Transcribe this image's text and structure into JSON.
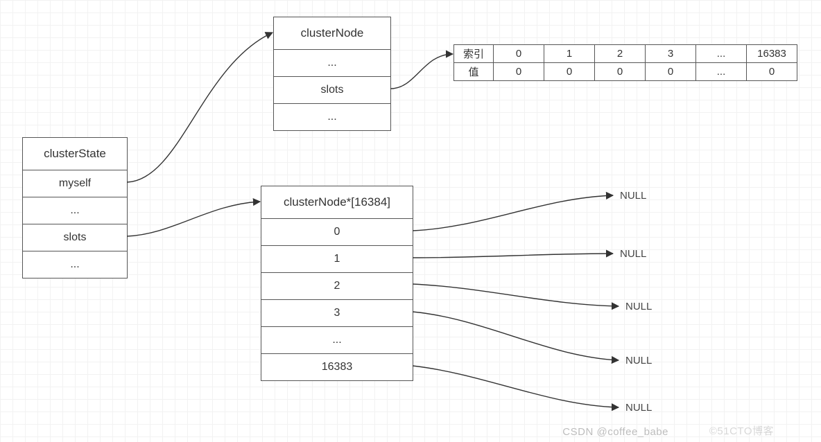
{
  "clusterState": {
    "title": "clusterState",
    "rows": [
      "myself",
      "...",
      "slots",
      "..."
    ]
  },
  "clusterNode": {
    "title": "clusterNode",
    "rows": [
      "...",
      "slots",
      "..."
    ]
  },
  "slotsArray": {
    "title": "clusterNode*[16384]",
    "rows": [
      "0",
      "1",
      "2",
      "3",
      "...",
      "16383"
    ]
  },
  "indexTable": {
    "headerLabel": "索引",
    "valueLabel": "值",
    "indices": [
      "0",
      "1",
      "2",
      "3",
      "...",
      "16383"
    ],
    "values": [
      "0",
      "0",
      "0",
      "0",
      "...",
      "0"
    ]
  },
  "nullLabels": [
    "NULL",
    "NULL",
    "NULL",
    "NULL",
    "NULL"
  ],
  "watermarks": {
    "left": "CSDN @coffee_babe",
    "right": "©51CTO博客"
  }
}
